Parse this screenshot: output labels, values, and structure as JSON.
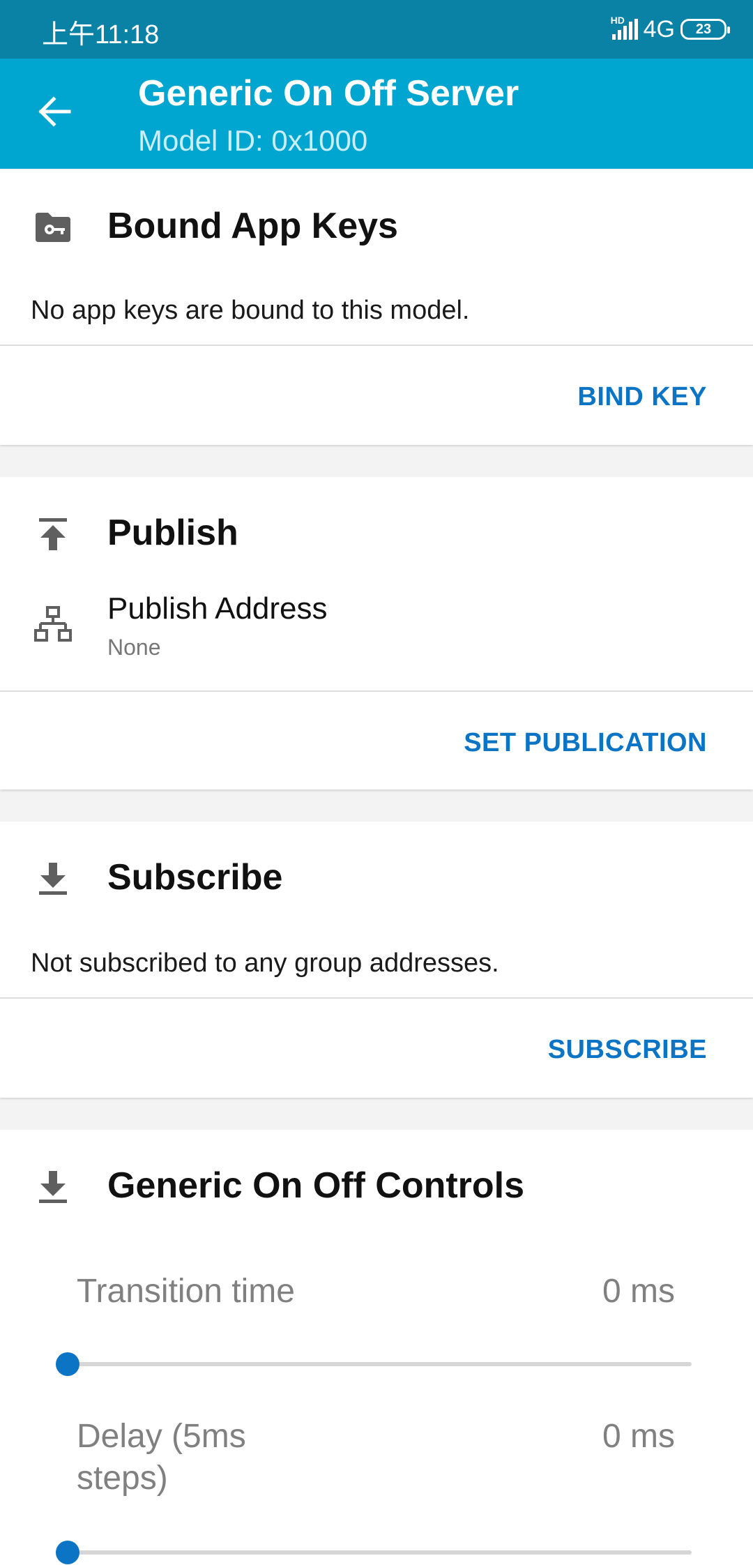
{
  "status_bar": {
    "time": "上午11:18",
    "hd_label": "HD",
    "network": "4G",
    "battery": "23"
  },
  "app_bar": {
    "title": "Generic On Off Server",
    "subtitle": "Model ID: 0x1000"
  },
  "bound_app_keys": {
    "title": "Bound App Keys",
    "message": "No app keys are bound to this model.",
    "action": "BIND KEY",
    "icon": "key-folder-icon"
  },
  "publish": {
    "title": "Publish",
    "address_label": "Publish Address",
    "address_value": "None",
    "action": "SET PUBLICATION",
    "icon": "publish-icon",
    "address_icon": "network-icon"
  },
  "subscribe": {
    "title": "Subscribe",
    "message": "Not subscribed to any group addresses.",
    "action": "SUBSCRIBE",
    "icon": "download-icon"
  },
  "controls": {
    "title": "Generic On Off Controls",
    "icon": "download-icon",
    "transition_label": "Transition time",
    "transition_value": "0 ms",
    "transition_fraction": 0,
    "delay_label_line1": "Delay (5ms",
    "delay_label_line2": "steps)",
    "delay_value": "0 ms",
    "delay_fraction": 0
  },
  "colors": {
    "status_bar": "#0a82a6",
    "app_bar": "#00a6cf",
    "accent": "#0b74c4"
  }
}
